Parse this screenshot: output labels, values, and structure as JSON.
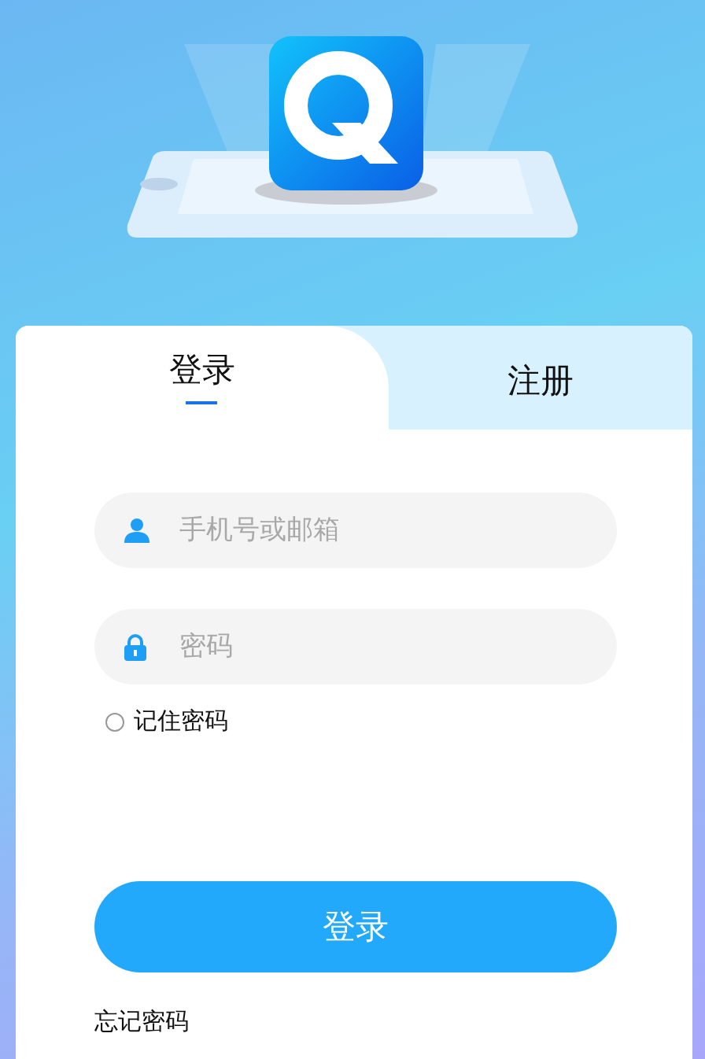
{
  "tabs": [
    {
      "label": "登录",
      "selected": true
    },
    {
      "label": "注册",
      "selected": false
    }
  ],
  "fields": [
    {
      "kind": "user",
      "placeholder": "手机号或邮箱"
    },
    {
      "kind": "password",
      "placeholder": "密码"
    }
  ],
  "remember": {
    "label": "记住密码",
    "checked": false
  },
  "login_button": "登录",
  "forgot_link": "忘记密码"
}
